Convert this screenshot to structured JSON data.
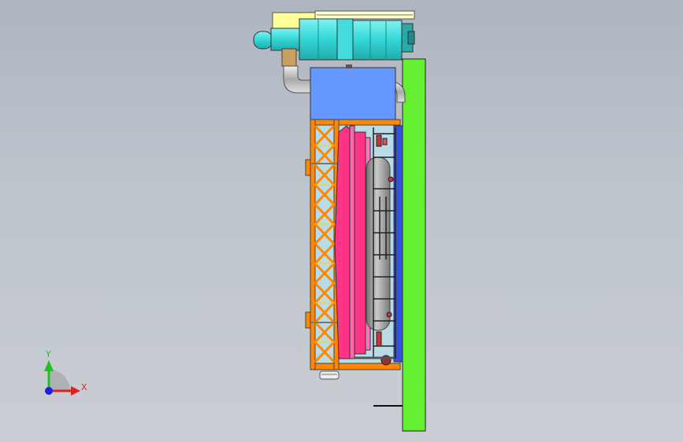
{
  "viewport": {
    "background_top": "#aeb5bf",
    "background_bottom": "#c9ced4"
  },
  "triad": {
    "x_label": "X",
    "y_label": "Y",
    "x_color": "#e02020",
    "y_color": "#20c020",
    "z_color": "#2020e0"
  },
  "model": {
    "colors": {
      "base_plate": "#66ee33",
      "blower": "#44dddd",
      "top_housing": "#ffff99",
      "upper_box": "#6699ff",
      "frame": "#ff8800",
      "pink_panel": "#ff3388",
      "tank": "#9a9a9a",
      "back_panel": "#3355dd",
      "pipe": "#c8c8c8"
    },
    "icons": [
      "blower-icon",
      "pipe-elbow-icon",
      "tank-icon",
      "ladder-icon",
      "valve-icon"
    ]
  }
}
